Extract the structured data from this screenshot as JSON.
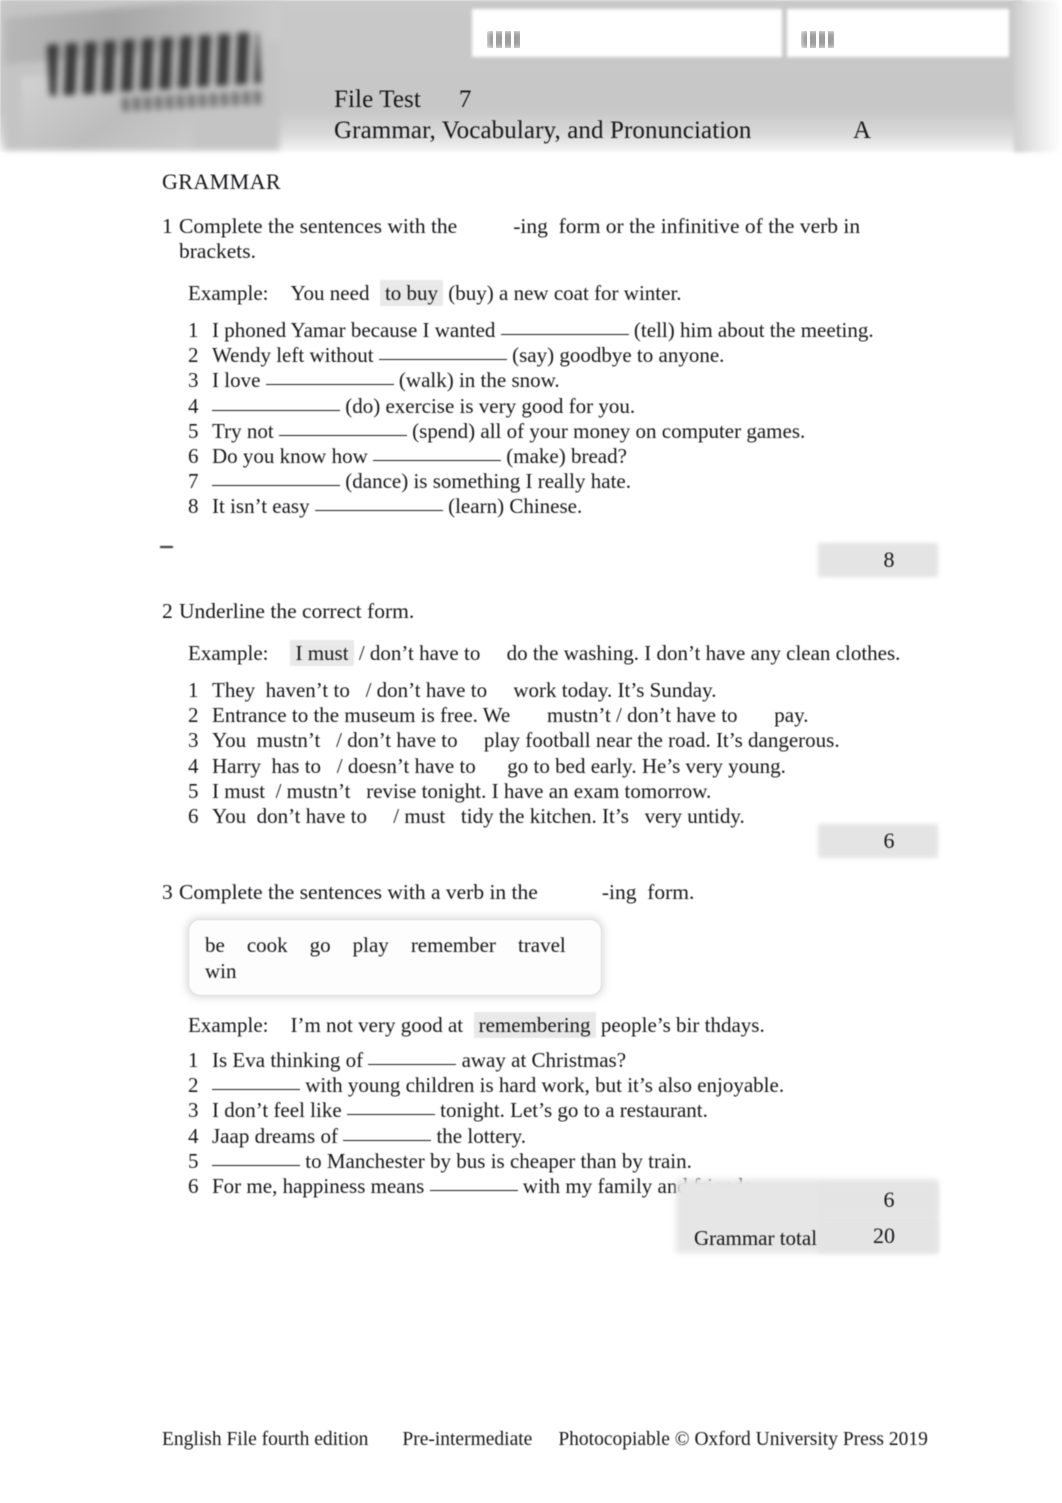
{
  "header": {
    "logo_alt": "English File",
    "name_field_label": "Name",
    "name_field_value": "",
    "class_field_label": "Class",
    "class_field_value": "",
    "title_line1_label": "File Test",
    "title_line1_number": "7",
    "title_line2": "Grammar, Vocabulary, and Pronunciation",
    "version": "A",
    "band_color": "#c8c8c8"
  },
  "section": {
    "heading": "GRAMMAR"
  },
  "exercises": [
    {
      "number": "1",
      "instruction_a": "Complete the sentences with the",
      "instruction_b": "-ing",
      "instruction_c": "form or the infinitive of the verb in brackets.",
      "example_label": "Example:",
      "example_pre": "You need",
      "example_answer": "to buy",
      "example_post": "(buy) a new coat for winter.",
      "items": [
        {
          "num": "1",
          "pre": "I phoned Yamar because I wanted",
          "post": "(tell) him about the meeting."
        },
        {
          "num": "2",
          "pre": "Wendy left without",
          "post": "(say) goodbye to anyone."
        },
        {
          "num": "3",
          "pre": "I love",
          "post": "(walk) in the snow."
        },
        {
          "num": "4",
          "pre": "",
          "post": "(do) exercise is very good for you."
        },
        {
          "num": "5",
          "pre": "Try not",
          "post": "(spend) all of your money on computer games."
        },
        {
          "num": "6",
          "pre": "Do you know how",
          "post": "(make) bread?"
        },
        {
          "num": "7",
          "pre": "",
          "post": "(dance) is something I really hate."
        },
        {
          "num": "8",
          "pre": "It isn’t easy",
          "post": "(learn) Chinese."
        }
      ],
      "score": "8"
    },
    {
      "number": "2",
      "instruction_a": "Underline the correct form.",
      "instruction_b": "",
      "instruction_c": "",
      "example_label": "Example:",
      "example_pre": "",
      "example_answer": "I must",
      "example_post": "/ don’t have to     do the washing. I don’t have any clean clothes.",
      "items": [
        {
          "num": "1",
          "pre": "They  haven’t to   / don’t have to     work today. It’s Sunday.",
          "post": ""
        },
        {
          "num": "2",
          "pre": "Entrance to the museum is free. We       mustn’t / don’t have to       pay.",
          "post": ""
        },
        {
          "num": "3",
          "pre": "You  mustn’t   / don’t have to     play football near the road. It’s dangerous.",
          "post": ""
        },
        {
          "num": "4",
          "pre": "Harry  has to   / doesn’t have to      go to bed early. He’s very young.",
          "post": ""
        },
        {
          "num": "5",
          "pre": "I must  / mustn’t   revise tonight. I have an exam tomorrow.",
          "post": ""
        },
        {
          "num": "6",
          "pre": "You  don’t have to     / must   tidy the kitchen. It’s   very untidy.",
          "post": ""
        }
      ],
      "score": "6"
    },
    {
      "number": "3",
      "instruction_a": "Complete the sentences with a verb in the",
      "instruction_b": "-ing",
      "instruction_c": "form.",
      "word_bank": [
        "be",
        "cook",
        "go",
        "play",
        "remember",
        "travel",
        "win"
      ],
      "example_label": "Example:",
      "example_pre": "I’m not very good at",
      "example_answer": "remembering",
      "example_post": "people’s bir thdays.",
      "items": [
        {
          "num": "1",
          "pre": "Is Eva thinking of",
          "post": "away at Christmas?"
        },
        {
          "num": "2",
          "pre": "",
          "post": "with young children is hard work, but it’s also enjoyable."
        },
        {
          "num": "3",
          "pre": "I don’t feel like",
          "post": "tonight. Let’s go to a restaurant."
        },
        {
          "num": "4",
          "pre": "Jaap dreams of",
          "post": "the lottery."
        },
        {
          "num": "5",
          "pre": "",
          "post": "to Manchester by bus is cheaper than by train."
        },
        {
          "num": "6",
          "pre": "For me, happiness means",
          "post": "with my family and friends."
        }
      ],
      "score": "6"
    }
  ],
  "totals": {
    "grammar_total_label": "Grammar total",
    "grammar_total_value": "20"
  },
  "footer": {
    "series": "English File fourth edition",
    "level": "Pre-intermediate",
    "copyright": "Photocopiable © Oxford University Press 2019"
  }
}
